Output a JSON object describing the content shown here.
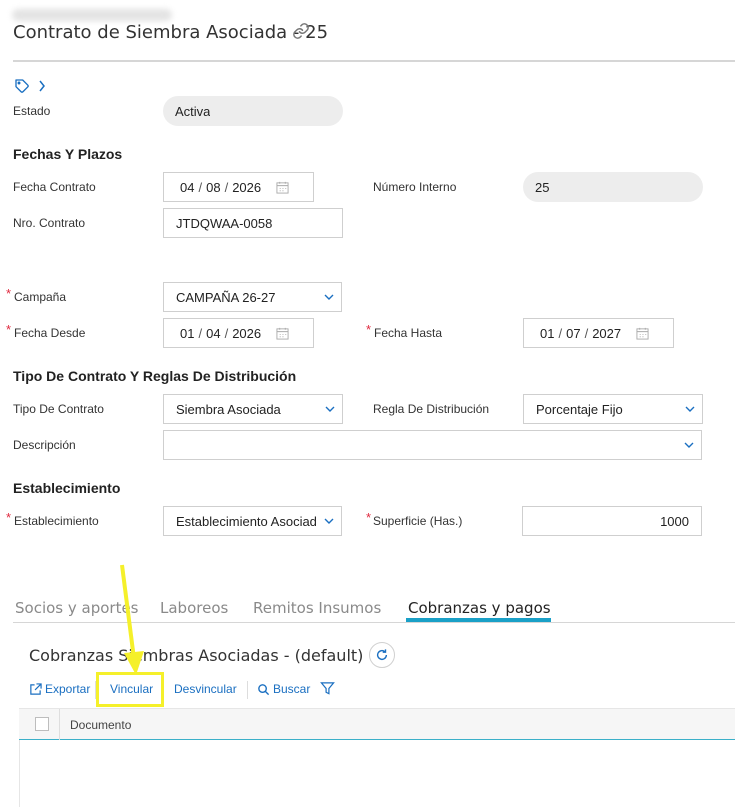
{
  "header": {
    "title": "Contrato de Siembra Asociada - 25"
  },
  "estado": {
    "label": "Estado",
    "value": "Activa"
  },
  "sections": {
    "fechas": "Fechas Y Plazos",
    "tipo": "Tipo De Contrato Y Reglas De Distribución",
    "establecimiento": "Establecimiento"
  },
  "fields": {
    "fecha_contrato": {
      "label": "Fecha Contrato",
      "day": "04",
      "month": "08",
      "year": "2026"
    },
    "numero_interno": {
      "label": "Número Interno",
      "value": "25"
    },
    "nro_contrato": {
      "label": "Nro. Contrato",
      "value": "JTDQWAA-0058"
    },
    "campana": {
      "label": "Campaña",
      "value": "CAMPAÑA 26-27"
    },
    "fecha_desde": {
      "label": "Fecha Desde",
      "day": "01",
      "month": "04",
      "year": "2026"
    },
    "fecha_hasta": {
      "label": "Fecha Hasta",
      "day": "01",
      "month": "07",
      "year": "2027"
    },
    "tipo_contrato": {
      "label": "Tipo De Contrato",
      "value": "Siembra Asociada"
    },
    "regla_distribucion": {
      "label": "Regla De Distribución",
      "value": "Porcentaje Fijo"
    },
    "descripcion": {
      "label": "Descripción",
      "value": ""
    },
    "establecimiento": {
      "label": "Establecimiento",
      "value": "Establecimiento Asociado"
    },
    "superficie": {
      "label": "Superficie (Has.)",
      "value": "1000"
    }
  },
  "date_separator": "/",
  "required_mark": "*",
  "tabs": [
    {
      "label": "Socios y aportes"
    },
    {
      "label": "Laboreos"
    },
    {
      "label": "Remitos Insumos"
    },
    {
      "label": "Cobranzas y pagos"
    }
  ],
  "grid": {
    "title": "Cobranzas Siembras Asociadas - (default)",
    "toolbar": {
      "exportar": "Exportar",
      "vincular": "Vincular",
      "desvincular": "Desvincular",
      "buscar": "Buscar"
    },
    "columns": [
      "Documento"
    ]
  },
  "colors": {
    "accent": "#1aa0c7",
    "link": "#1a6fc1",
    "required": "#e0283e",
    "annotation": "#f5f02a"
  }
}
